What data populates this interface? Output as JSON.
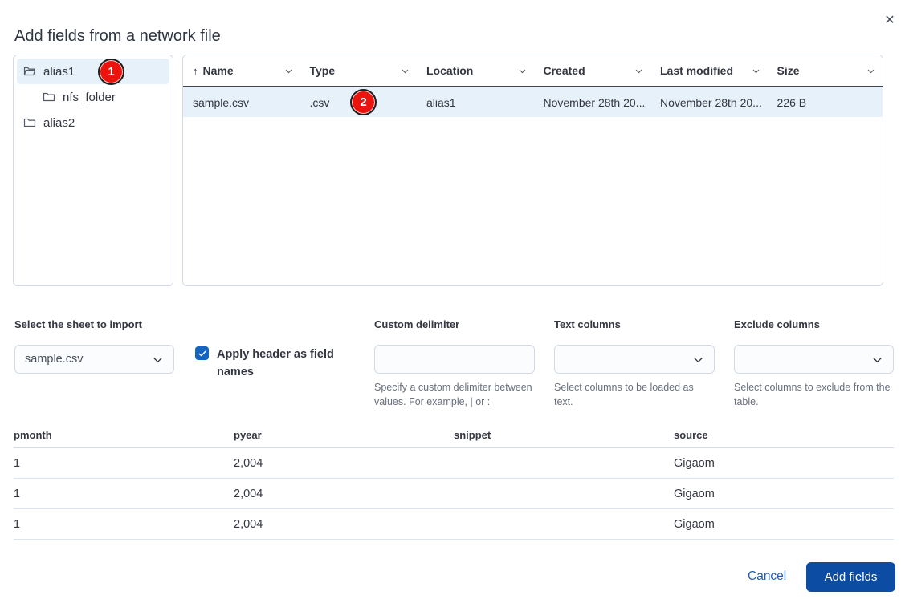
{
  "dialog": {
    "title": "Add fields from a network file",
    "close_icon": "✕"
  },
  "colors": {
    "primary_button": "#0c4ca3",
    "cancel_link": "#1f5fb0",
    "selection_bg": "#e6f1fa",
    "checkbox_blue": "#1565c0",
    "annotation_badge_red": "#ea140c"
  },
  "tree": {
    "items": [
      {
        "label": "alias1",
        "selected": true
      },
      {
        "label": "nfs_folder",
        "selected": false
      },
      {
        "label": "alias2",
        "selected": false
      }
    ]
  },
  "file_table": {
    "sort_icon": "↑",
    "columns": [
      "Name",
      "Type",
      "Location",
      "Created",
      "Last modified",
      "Size"
    ],
    "rows": [
      [
        "sample.csv",
        ".csv",
        "alias1",
        "November 28th 20...",
        "November 28th 20...",
        "226 B"
      ]
    ]
  },
  "form": {
    "sheet": {
      "label": "Select the sheet to import",
      "value": "sample.csv"
    },
    "apply_header": {
      "label": "Apply header as field names",
      "checked": true
    },
    "delimiter": {
      "label": "Custom delimiter",
      "value": "",
      "help": "Specify a custom delimiter between values. For example, | or :"
    },
    "text_columns": {
      "label": "Text columns",
      "value": "",
      "help": "Select columns to be loaded as text."
    },
    "exclude_columns": {
      "label": "Exclude columns",
      "value": "",
      "help": "Select columns to exclude from the table."
    }
  },
  "preview": {
    "columns": [
      "pmonth",
      "pyear",
      "snippet",
      "source"
    ],
    "rows": [
      [
        "1",
        "2,004",
        "",
        "Gigaom"
      ],
      [
        "1",
        "2,004",
        "",
        "Gigaom"
      ],
      [
        "1",
        "2,004",
        "",
        "Gigaom"
      ]
    ]
  },
  "footer": {
    "cancel": "Cancel",
    "add": "Add fields"
  },
  "annotations": [
    {
      "number": "1"
    },
    {
      "number": "2"
    }
  ]
}
